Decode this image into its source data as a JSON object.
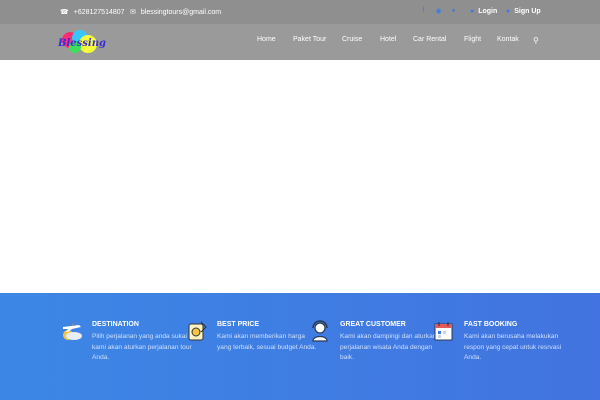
{
  "topbar": {
    "phone": "+628127514807",
    "email": "blessingtours@gmail.com",
    "login": "Login",
    "signup": "Sign Up",
    "icons": [
      "phone-icon",
      "envelope-icon",
      "facebook-icon",
      "instagram-icon",
      "twitter-icon",
      "user-icon",
      "user-plus-icon"
    ]
  },
  "logo": {
    "text": "Blessing"
  },
  "nav": [
    {
      "label": "Home"
    },
    {
      "label": "Paket Tour"
    },
    {
      "label": "Cruise"
    },
    {
      "label": "Hotel"
    },
    {
      "label": "Car Rental"
    },
    {
      "label": "Flight"
    },
    {
      "label": "Kontak"
    }
  ],
  "features": [
    {
      "title": "DESTINATION",
      "text": "Pilih perjalanan yang anda sukai kami akan aturkan perjalanan tour Anda.",
      "icon": "plane-cloud-icon"
    },
    {
      "title": "BEST PRICE",
      "text": "Kami akan memberikan harga yang terbaik, sesuai budget Anda.",
      "icon": "price-tag-icon"
    },
    {
      "title": "GREAT CUSTOMER",
      "text": "Kami akan dampingi dan aturkan perjalanan wisata Anda dengan baik.",
      "icon": "customer-support-icon"
    },
    {
      "title": "FAST BOOKING",
      "text": "Kami akan berusaha melakukan respon yang cepat untuk resrvasi Anda.",
      "icon": "calendar-icon"
    }
  ],
  "colors": {
    "topbar": "#8f8f8f",
    "navbar": "#9a9a9a",
    "accent": "#3d7be0",
    "features_start": "#3c87e6",
    "features_end": "#4273e0"
  }
}
